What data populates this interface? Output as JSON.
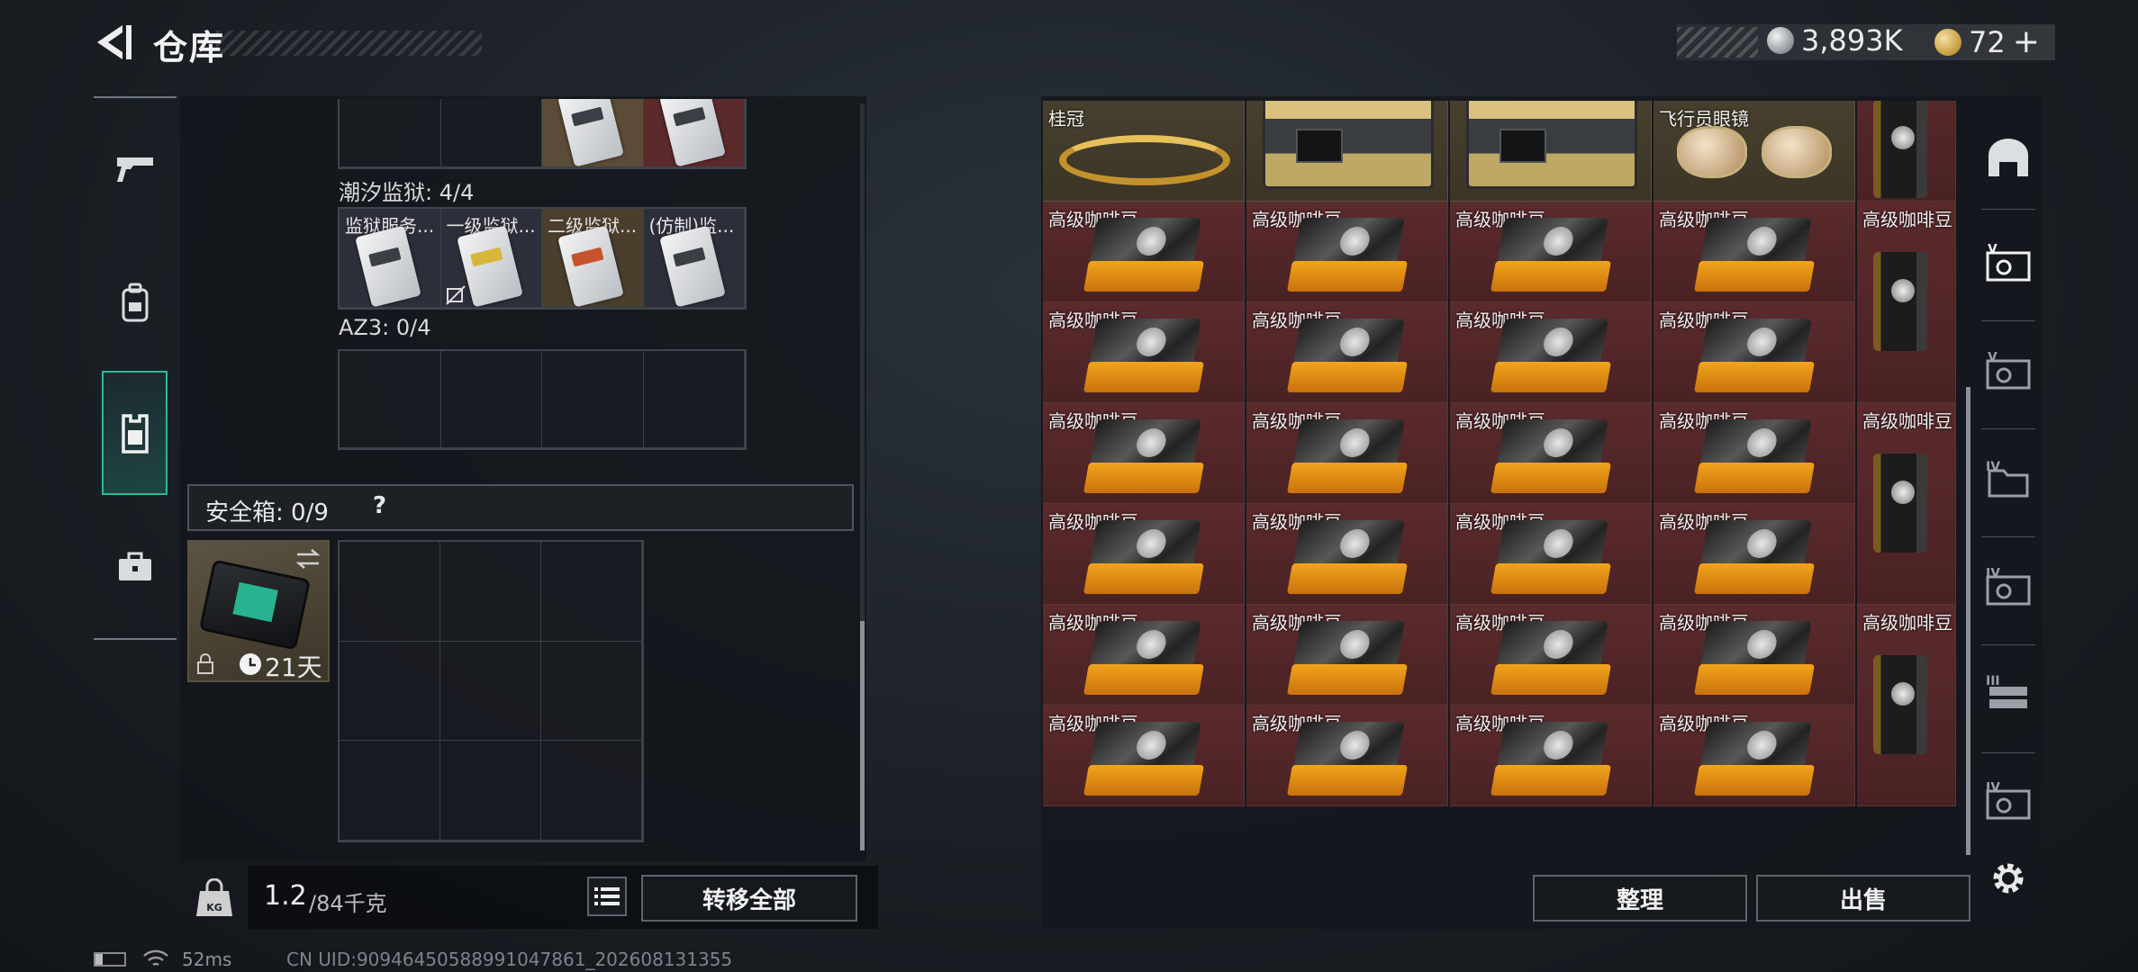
{
  "header": {
    "title": "仓库",
    "currency_silver": "3,893K",
    "currency_gold": "72",
    "add_symbol": "+"
  },
  "left_nav": {
    "items": [
      {
        "icon": "pistol-icon"
      },
      {
        "icon": "backpack-icon"
      },
      {
        "icon": "vest-icon",
        "active": true
      },
      {
        "icon": "toolbox-icon"
      }
    ]
  },
  "containers": {
    "tide_prison": {
      "label": "潮汐监狱: 4/4",
      "slots": [
        "监狱服务...",
        "一级监狱...",
        "二级监狱...",
        "(仿制)监..."
      ]
    },
    "az3": {
      "label": "AZ3: 0/4"
    },
    "safe_box": {
      "label": "安全箱: 0/9",
      "help": "?",
      "days": "21天"
    }
  },
  "weight": {
    "current": "1.2",
    "max": "/84千克"
  },
  "buttons": {
    "transfer_all": "转移全部",
    "organize": "整理",
    "sell": "出售"
  },
  "stash": {
    "crown_label": "桂冠",
    "goggles_label": "飞行员眼镜",
    "coffee_label": "高级咖啡豆"
  },
  "status": {
    "ping": "52ms",
    "uid": "CN UID:90946450588991047861_202608131355"
  },
  "right_icons": [
    "bunker-icon",
    "stash-v-icon",
    "stash-v2-icon",
    "stash-iv-icon",
    "stash-iv2-icon",
    "stash-iii-icon",
    "stash-iv3-icon",
    "settings-icon"
  ]
}
